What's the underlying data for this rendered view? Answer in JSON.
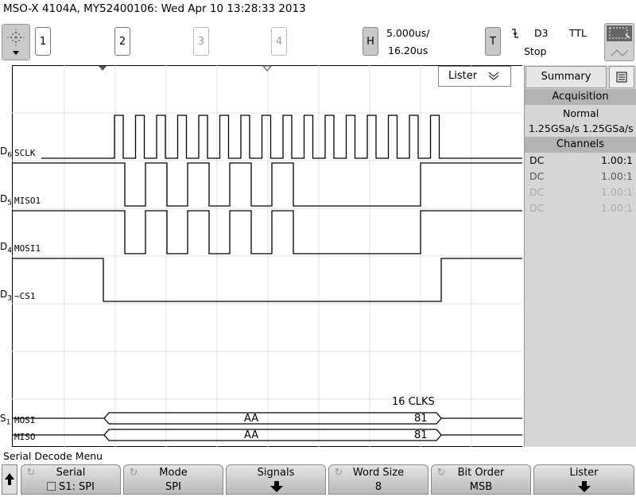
{
  "title": "MSO-X 4104A, MY52400106: Wed Apr 10 13:28:33 2013",
  "channels": [
    "1",
    "2",
    "3",
    "4"
  ],
  "horizontal": {
    "key": "H",
    "scale": "5.000us/",
    "delay": "16.20us"
  },
  "trigger": {
    "key": "T",
    "source": "D3",
    "level": "TTL",
    "state": "Stop"
  },
  "lister": {
    "label": "Lister"
  },
  "digital_labels": [
    {
      "ch": "D",
      "sub": "6",
      "name": "SCLK"
    },
    {
      "ch": "D",
      "sub": "5",
      "name": "MISO1"
    },
    {
      "ch": "D",
      "sub": "4",
      "name": "MOSI1"
    },
    {
      "ch": "D",
      "sub": "3",
      "name": "~CS1"
    }
  ],
  "bus": {
    "ch": "S",
    "sub": "1",
    "lines": [
      {
        "name": "MOSI",
        "v1": "AA",
        "v2": "81"
      },
      {
        "name": "MISO",
        "v1": "AA",
        "v2": "81"
      }
    ],
    "clks": "16 CLKS"
  },
  "waveforms": {
    "sclk_pulses": 16,
    "miso_bits": "10101010",
    "mosi_bits": "10101010"
  },
  "sidebar": {
    "tab": "Summary",
    "acq_header": "Acquisition",
    "acq_mode": "Normal",
    "acq_rate": "1.25GSa/s 1.25GSa/s",
    "ch_header": "Channels",
    "channels": [
      {
        "coupling": "DC",
        "probe": "1.00:1",
        "active": true
      },
      {
        "coupling": "DC",
        "probe": "1.00:1",
        "active": true
      },
      {
        "coupling": "DC",
        "probe": "1.00:1",
        "active": false
      },
      {
        "coupling": "DC",
        "probe": "1.00:1",
        "active": false
      }
    ]
  },
  "menu": {
    "title": "Serial Decode Menu",
    "keys": [
      {
        "l1": "Serial",
        "l2": "S1: SPI"
      },
      {
        "l1": "Mode",
        "l2": "SPI"
      },
      {
        "l1": "Signals",
        "l2": ""
      },
      {
        "l1": "Word Size",
        "l2": "8"
      },
      {
        "l1": "Bit Order",
        "l2": "MSB"
      },
      {
        "l1": "Lister",
        "l2": ""
      }
    ]
  }
}
